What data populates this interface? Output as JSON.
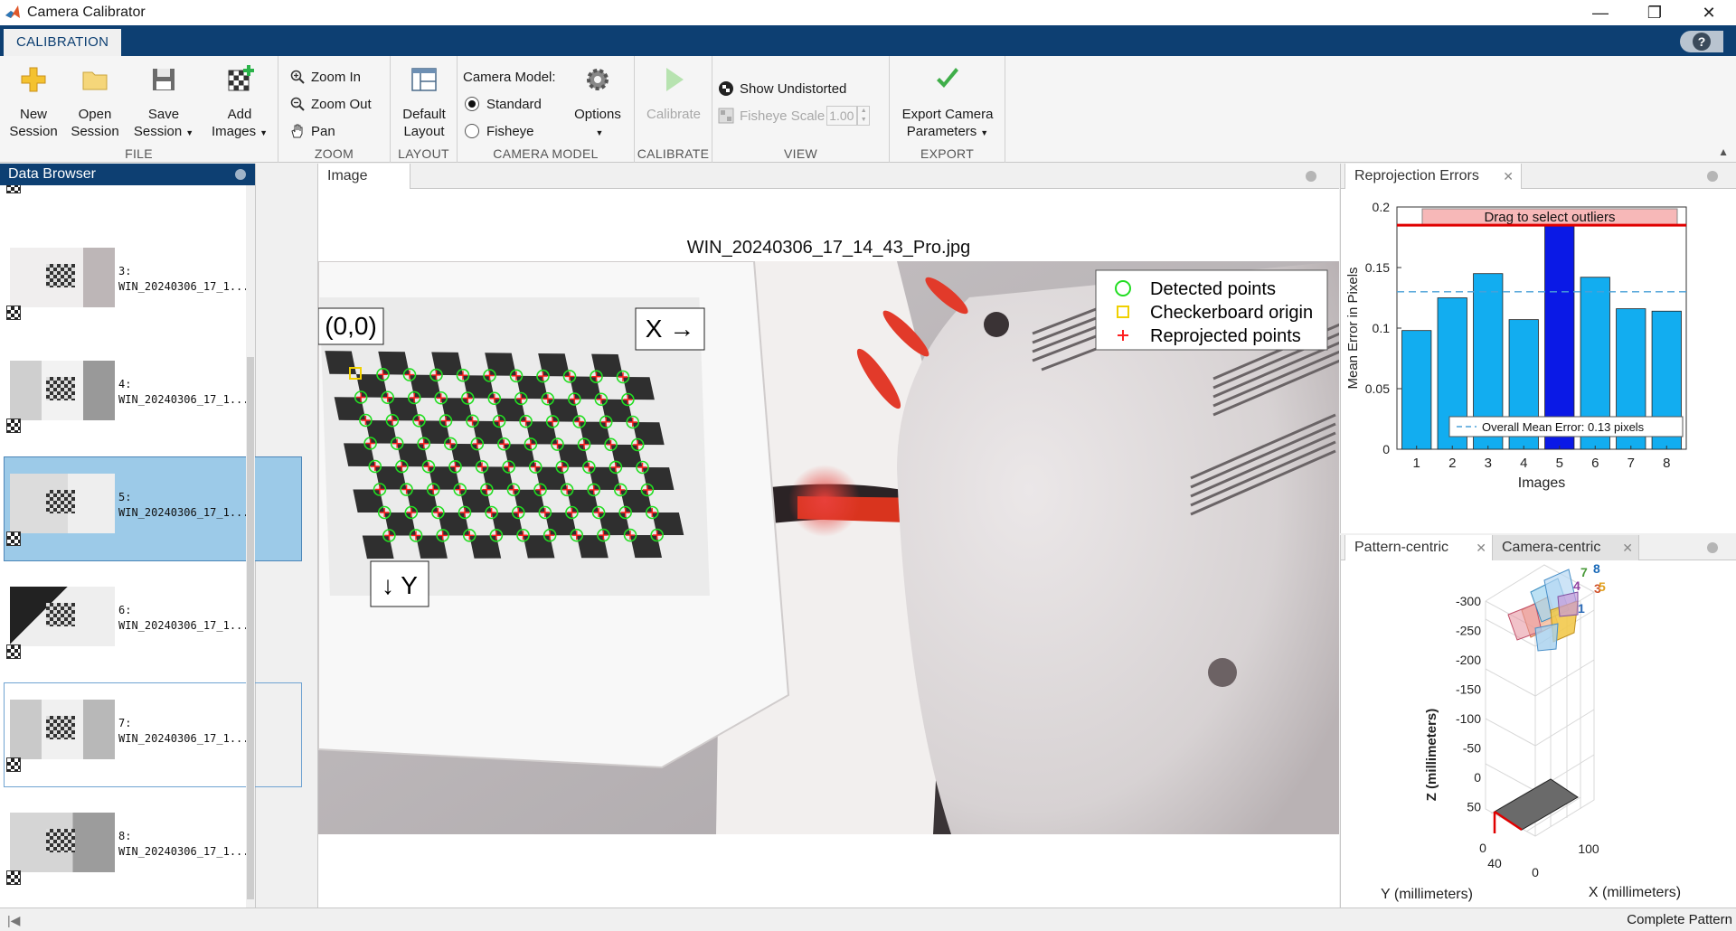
{
  "window": {
    "title": "Camera Calibrator",
    "min": "—",
    "max": "❐",
    "close": "✕"
  },
  "ribbon": {
    "tab": "CALIBRATION",
    "help": "?",
    "file": {
      "label": "FILE",
      "new_session": [
        "New",
        "Session"
      ],
      "open_session": [
        "Open",
        "Session"
      ],
      "save_session": [
        "Save",
        "Session"
      ],
      "add_images": [
        "Add",
        "Images"
      ]
    },
    "zoom": {
      "label": "ZOOM",
      "zoom_in": "Zoom In",
      "zoom_out": "Zoom Out",
      "pan": "Pan"
    },
    "layout": {
      "label": "LAYOUT",
      "default_layout": [
        "Default",
        "Layout"
      ]
    },
    "camera_model": {
      "label": "CAMERA MODEL",
      "heading": "Camera Model:",
      "standard": "Standard",
      "fisheye": "Fisheye",
      "selected": "Standard",
      "options": "Options"
    },
    "calibrate": {
      "label": "CALIBRATE",
      "button": "Calibrate"
    },
    "view": {
      "label": "VIEW",
      "show_undistorted": "Show Undistorted",
      "fisheye_scale_label": "Fisheye Scale",
      "fisheye_scale_value": "1.00"
    },
    "export": {
      "label": "EXPORT",
      "button": [
        "Export Camera",
        "Parameters"
      ]
    }
  },
  "data_browser": {
    "title": "Data Browser",
    "items": [
      {
        "index": "3:",
        "name": "WIN_20240306_17_1...",
        "selected": false,
        "focused": false
      },
      {
        "index": "4:",
        "name": "WIN_20240306_17_1...",
        "selected": false,
        "focused": false
      },
      {
        "index": "5:",
        "name": "WIN_20240306_17_1...",
        "selected": true,
        "focused": false
      },
      {
        "index": "6:",
        "name": "WIN_20240306_17_1...",
        "selected": false,
        "focused": false
      },
      {
        "index": "7:",
        "name": "WIN_20240306_17_1...",
        "selected": false,
        "focused": true
      },
      {
        "index": "8:",
        "name": "WIN_20240306_17_1...",
        "selected": false,
        "focused": false
      }
    ]
  },
  "image_panel": {
    "tab": "Image",
    "filename": "WIN_20240306_17_14_43_Pro.jpg",
    "origin_label": "(0,0)",
    "x_label": "X →",
    "y_label": "↓ Y",
    "legend": {
      "detected": "Detected points",
      "origin": "Checkerboard origin",
      "reprojected": "Reprojected points"
    },
    "colors": {
      "detected": "#22dd22",
      "origin": "#f0d000",
      "reprojected": "#ff2020"
    }
  },
  "reprojection": {
    "tab": "Reprojection Errors",
    "banner": "Drag to select outliers",
    "legend": "Overall Mean Error: 0.13 pixels",
    "xlabel": "Images",
    "ylabel": "Mean Error in Pixels"
  },
  "chart_data": {
    "type": "bar",
    "categories": [
      "1",
      "2",
      "3",
      "4",
      "5",
      "6",
      "7",
      "8"
    ],
    "values": [
      0.098,
      0.125,
      0.145,
      0.107,
      0.185,
      0.142,
      0.116,
      0.114
    ],
    "selected_index": 4,
    "mean": 0.13,
    "threshold": 0.185,
    "ylim": [
      0,
      0.2
    ],
    "yticks": [
      "0",
      "0.05",
      "0.1",
      "0.15",
      "0.2"
    ],
    "xlabel": "Images",
    "ylabel": "Mean Error in Pixels",
    "colors": {
      "bar": "#12adf0",
      "selected": "#0a19e6",
      "mean": "#4aa0d8",
      "threshold": "#e00000"
    }
  },
  "extrinsics": {
    "tabs": [
      "Pattern-centric",
      "Camera-centric"
    ],
    "zlabel": "Z (millimeters)",
    "ylabel": "Y (millimeters)",
    "xlabel": "X (millimeters)",
    "zticks": [
      "-300",
      "-250",
      "-200",
      "-150",
      "-100",
      "-50",
      "0",
      "50"
    ],
    "yticks": [
      "0",
      "40"
    ],
    "xticks": [
      "0",
      "100"
    ],
    "camera_labels": [
      "7",
      "8",
      "4",
      "3",
      "5",
      "1"
    ]
  },
  "status": {
    "message": "Complete Pattern"
  }
}
